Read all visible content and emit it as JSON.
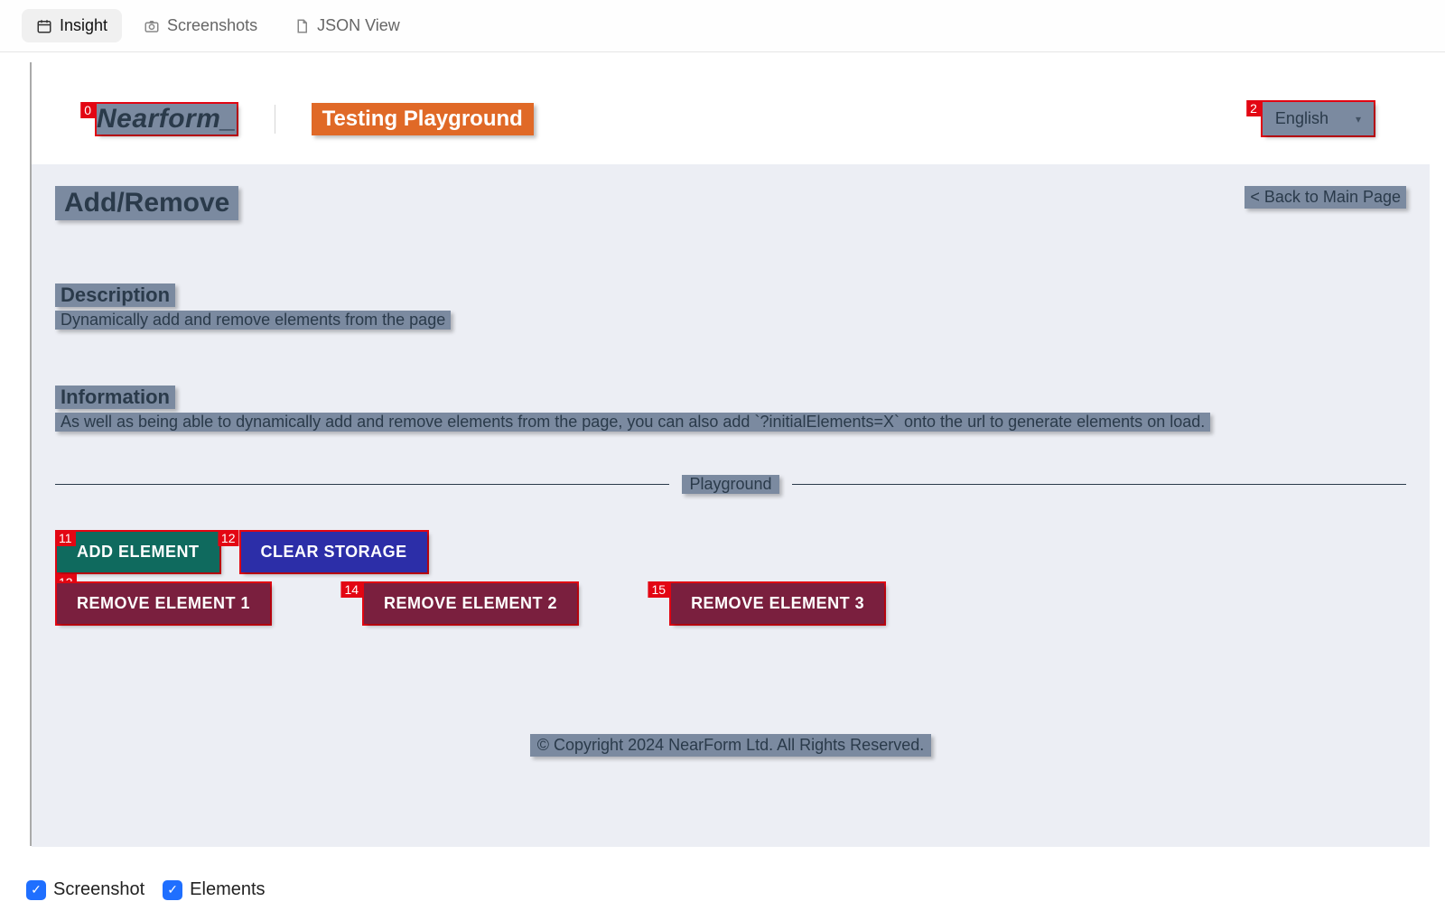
{
  "toolbar": {
    "tabs": [
      {
        "name": "insight",
        "label": "Insight",
        "active": true
      },
      {
        "name": "screenshots",
        "label": "Screenshots",
        "active": false
      },
      {
        "name": "json-view",
        "label": "JSON View",
        "active": false
      }
    ]
  },
  "overlays": {
    "brand_idx": "0",
    "lang_idx": "2",
    "add_idx": "11",
    "clear_idx": "12",
    "remove1_idx": "13",
    "remove2_idx": "14",
    "remove3_idx": "15"
  },
  "page": {
    "brand": "Nearform_",
    "app_name": "Testing Playground",
    "language": "English",
    "title": "Add/Remove",
    "back_link": "< Back to Main Page",
    "desc_heading": "Description",
    "desc_text": "Dynamically add and remove elements from the page",
    "info_heading": "Information",
    "info_text": "As well as being able to dynamically add and remove elements from the page, you can also add `?initialElements=X` onto the url to generate elements on load.",
    "playground_label": "Playground",
    "buttons": {
      "add": "ADD ELEMENT",
      "clear": "CLEAR STORAGE",
      "remove": [
        "REMOVE ELEMENT 1",
        "REMOVE ELEMENT 2",
        "REMOVE ELEMENT 3"
      ]
    },
    "footer": "© Copyright 2024 NearForm Ltd. All Rights Reserved."
  },
  "bottom": {
    "screenshot": "Screenshot",
    "elements": "Elements"
  }
}
